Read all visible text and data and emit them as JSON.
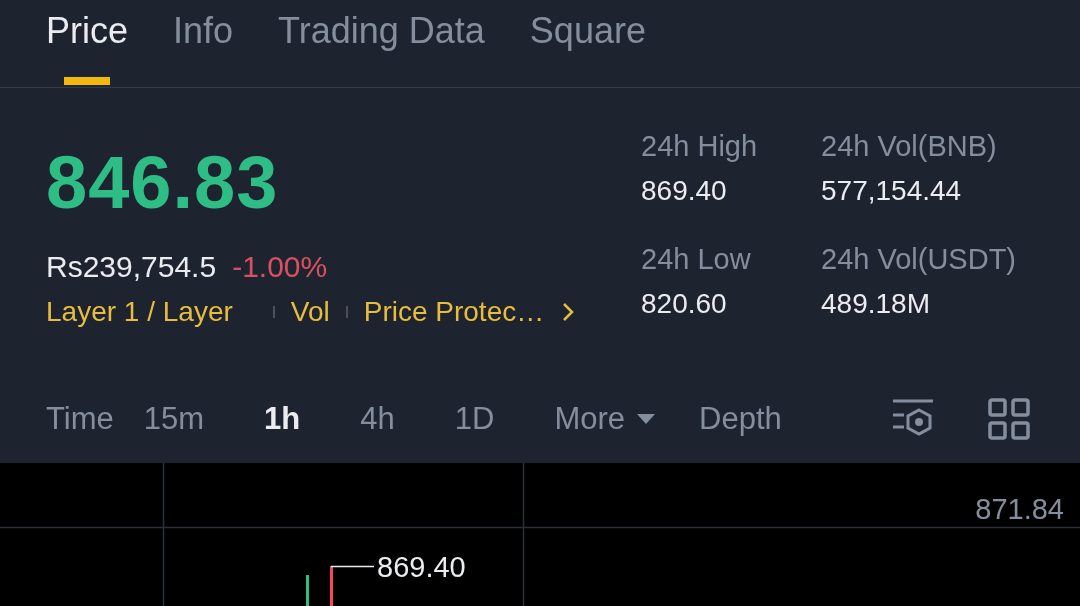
{
  "tabs": [
    {
      "label": "Price",
      "selected": true
    },
    {
      "label": "Info",
      "selected": false
    },
    {
      "label": "Trading Data",
      "selected": false
    },
    {
      "label": "Square",
      "selected": false
    }
  ],
  "price": {
    "value": "846.83",
    "fiat": "Rs239,754.5",
    "change": "-1.00%",
    "tags": [
      "Layer 1 / Layer",
      "Vol",
      "Price Protec…"
    ]
  },
  "stats": [
    {
      "label": "24h High",
      "value": "869.40"
    },
    {
      "label": "24h Vol(BNB)",
      "value": "577,154.44"
    },
    {
      "label": "24h Low",
      "value": "820.60"
    },
    {
      "label": "24h Vol(USDT)",
      "value": "489.18M"
    }
  ],
  "intervals": [
    {
      "label": "Time",
      "kind": "interval",
      "selected": false
    },
    {
      "label": "15m",
      "kind": "interval",
      "selected": false
    },
    {
      "label": "1h",
      "kind": "interval",
      "selected": true
    },
    {
      "label": "4h",
      "kind": "interval",
      "selected": false
    },
    {
      "label": "1D",
      "kind": "interval",
      "selected": false
    },
    {
      "label": "More",
      "kind": "dropdown",
      "selected": false
    },
    {
      "label": "Depth",
      "kind": "interval",
      "selected": false
    }
  ],
  "chart": {
    "axis_label": "871.84",
    "high_marker": "869.40"
  }
}
